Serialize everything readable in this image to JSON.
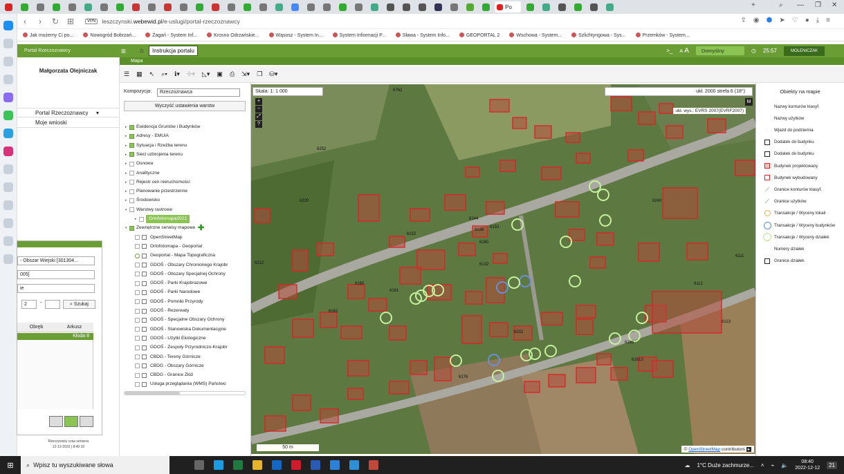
{
  "browser": {
    "active_tab": "Po",
    "url_host": "leszczynski.",
    "url_domain": "webewid.pl",
    "url_path": "/e-uslugi/portal-rzeczoznawcy",
    "vpn": "VPN",
    "bookmarks": [
      "Jak możemy Ci po...",
      "Nowogród Bobrzań...",
      "Żagań - System Inf...",
      "Krosno Odrzańskie...",
      "Wąsosz - System In...",
      "System Informacji P...",
      "Sława - System Info...",
      "GEOPORTAL 2",
      "Wschowa - System...",
      "Szlichtyngowa - Sys...",
      "Przemków - System..."
    ]
  },
  "app": {
    "logo": "Portal Rzeczoznawcy",
    "instr": "Instrukcja portalu",
    "profile": "Domyślny",
    "time": "25:57",
    "user": "MOLENICZAK",
    "font_small": "A",
    "font_large": "A",
    "font_sep": "A"
  },
  "left": {
    "user_name": "Małgorzata Olejniczak",
    "menu_portal": "Portal Rzeczoznawcy",
    "menu_wnioski": "Moje wnioski",
    "search": {
      "obszar": "- Obszar Wiejski [301304...",
      "code": "005]",
      "third": "ie",
      "num1": "2",
      "dash": "-",
      "num2": "",
      "search_btn": "Szukaj",
      "col_obreb": "Obręb",
      "col_arkusz": "Arkusz",
      "row_value": "Kłoda 8"
    },
    "footer1": "Rzeczywisty czas serwera",
    "footer2": "12-12-2022 | 8:40:10"
  },
  "map": {
    "header": "Mapa",
    "scale": "Skala: 1: 1 000",
    "crs": "ukł. 2000 strefa 6 (18°)",
    "m_btn": "M",
    "height": "ukł. wys.: EVRS 2007(EVRF2007)",
    "scalebar": "50 m",
    "osm_prefix": "©",
    "osm_link": "OpenStreetMap",
    "osm_suffix": "contributors",
    "parcels": [
      "6762",
      "6252",
      "6220",
      "6138",
      "6153",
      "6152",
      "6144",
      "6212",
      "6132",
      "6202",
      "6166",
      "6165",
      "6182",
      "6181",
      "6180",
      "6240",
      "61613",
      "6176",
      "6112",
      "6113",
      "6111"
    ]
  },
  "layers": {
    "komp_label": "Kompozycja:",
    "komp_value": "Rzeczoznawca",
    "clear": "Wyczyść ustawienia warstw",
    "items": [
      "Ewidencja Gruntów i Budynków",
      "Adresy - EMUiA",
      "Sytuacja i Rzeźba terenu",
      "Sieci uzbrojenia terenu",
      "Osnowa",
      "Analityczne",
      "Rejestr cen nieruchomości",
      "Planowanie przestrzenne",
      "Środowisko",
      "Warstwy rastrowe",
      "Ortofotomapa2021",
      "Zewnętrzne serwisy mapowe",
      "OpenStreetMap",
      "Ortofotomapa - Geoportal",
      "Geoportal - Mapa Topograficzna",
      "GDOŚ - Obszary Chronionego Krajobr",
      "GDOŚ - Obszary Specjalnej Ochrony",
      "GDOŚ - Parki Krajobrazowe",
      "GDOŚ - Parki Narodowe",
      "GDOŚ - Pomniki Przyrody",
      "GDOŚ - Rezerwaty",
      "GDOŚ - Specjalne Obszary Ochrony",
      "GDOŚ - Stanowiska Dokumentacyjne",
      "GDOŚ - Użytki Ekologiczne",
      "GDOŚ - Zespoły Przyrodniczo-Krajobr",
      "CBDG - Tereny Górnicze",
      "CBDG - Obszary Górnicze",
      "CBDG - Granice Złóż",
      "Usługa przeglądania (WMS) Państwo"
    ]
  },
  "legend": {
    "title": "Obiekty na mapie",
    "items": [
      "Nazwy konturów klasyf.",
      "Nazwy użytków",
      "Wjazd do podziemia",
      "Dodatek do budynku",
      "Dodatek do budynku",
      "Budynek projektowany",
      "Budynek wybudowany",
      "Granice konturów klasyf.",
      "Granice użytków",
      "Transakcje / Wyceny lokali",
      "Transakcje / Wyceny budynków",
      "Transakcje / Wyceny działek",
      "Numery działek",
      "Granice działek"
    ]
  },
  "taskbar": {
    "search": "Wpisz tu wyszukiwane słowa",
    "weather": "1°C  Duże zachmurze...",
    "time": "08:40",
    "date": "2022-12-12",
    "notif": "21"
  },
  "colors": {
    "green": "#6a9e35",
    "light_green": "#8cc453",
    "building": "#d8262a",
    "circle": "#c8f0a0"
  }
}
